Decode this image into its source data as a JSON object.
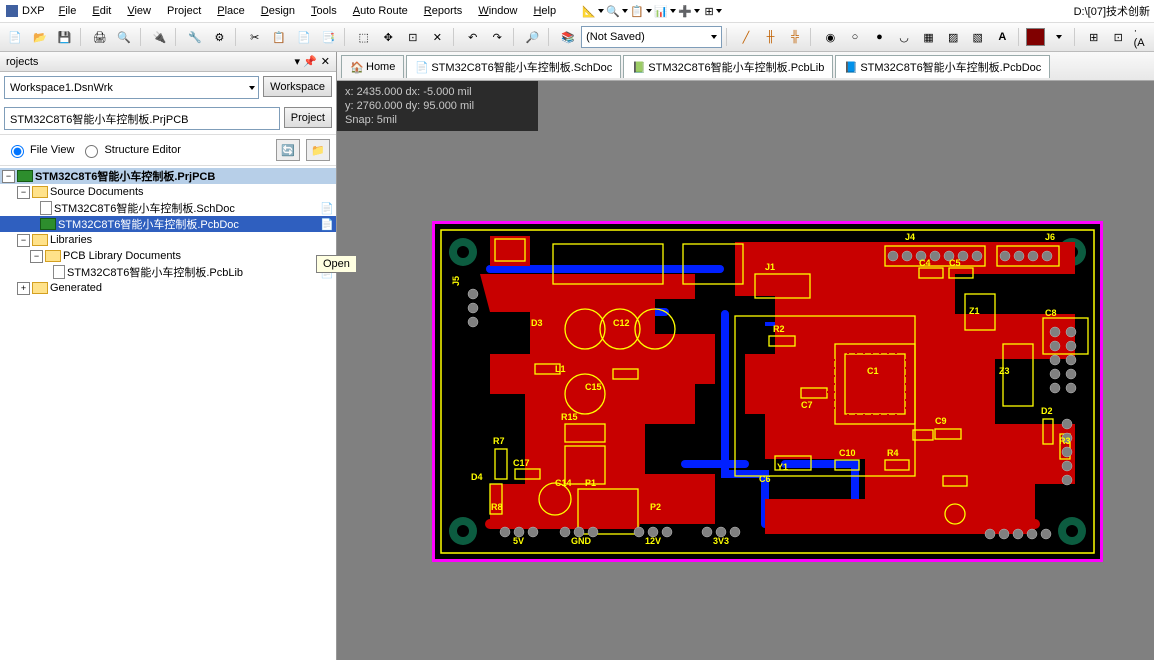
{
  "app": {
    "name": "DXP",
    "path": "D:\\[07]技术创新"
  },
  "menu": [
    "File",
    "Edit",
    "View",
    "Project",
    "Place",
    "Design",
    "Tools",
    "Auto Route",
    "Reports",
    "Window",
    "Help"
  ],
  "toolbar": {
    "not_saved": "(Not Saved)"
  },
  "panel": {
    "title": "rojects",
    "workspace": "Workspace1.DsnWrk",
    "workspace_btn": "Workspace",
    "project": "STM32C8T6智能小车控制板.PrjPCB",
    "project_btn": "Project",
    "fileview": "File View",
    "structure": "Structure Editor"
  },
  "tree": {
    "root": "STM32C8T6智能小车控制板.PrjPCB",
    "src": "Source Documents",
    "sch": "STM32C8T6智能小车控制板.SchDoc",
    "pcb": "STM32C8T6智能小车控制板.PcbDoc",
    "libs": "Libraries",
    "pcblib_folder": "PCB Library Documents",
    "pcblib": "STM32C8T6智能小车控制板.PcbLib",
    "gen": "Generated"
  },
  "tooltip": "Open",
  "tabs": {
    "home": "Home",
    "t1": "STM32C8T6智能小车控制板.SchDoc",
    "t2": "STM32C8T6智能小车控制板.PcbLib",
    "t3": "STM32C8T6智能小车控制板.PcbDoc"
  },
  "coords": {
    "l1": "x:  2435.000    dx:     -5.000   mil",
    "l2": "y:  2760.000    dy:     95.000   mil",
    "l3": "Snap: 5mil"
  },
  "silk": {
    "j5": "J5",
    "j4": "J4",
    "j6": "J6",
    "j1": "J1",
    "d3": "D3",
    "c12": "C12",
    "c4": "C4",
    "c5": "C5",
    "c8": "C8",
    "r2": "R2",
    "r7": "R7",
    "c17": "C17",
    "l1": "L1",
    "c1": "C1",
    "c15": "C15",
    "r15": "R15",
    "c7": "C7",
    "c9": "C9",
    "z1": "Z1",
    "z3": "Z3",
    "d2": "D2",
    "r3": "R3",
    "d4": "D4",
    "r8": "R8",
    "p1": "P1",
    "p2": "P2",
    "y1": "Y1",
    "c10": "C10",
    "r4": "R4",
    "c6": "C6",
    "c14": "C14",
    "v5": "5V",
    "gnd": "GND",
    "v12": "12V",
    "v3": "3V3"
  }
}
